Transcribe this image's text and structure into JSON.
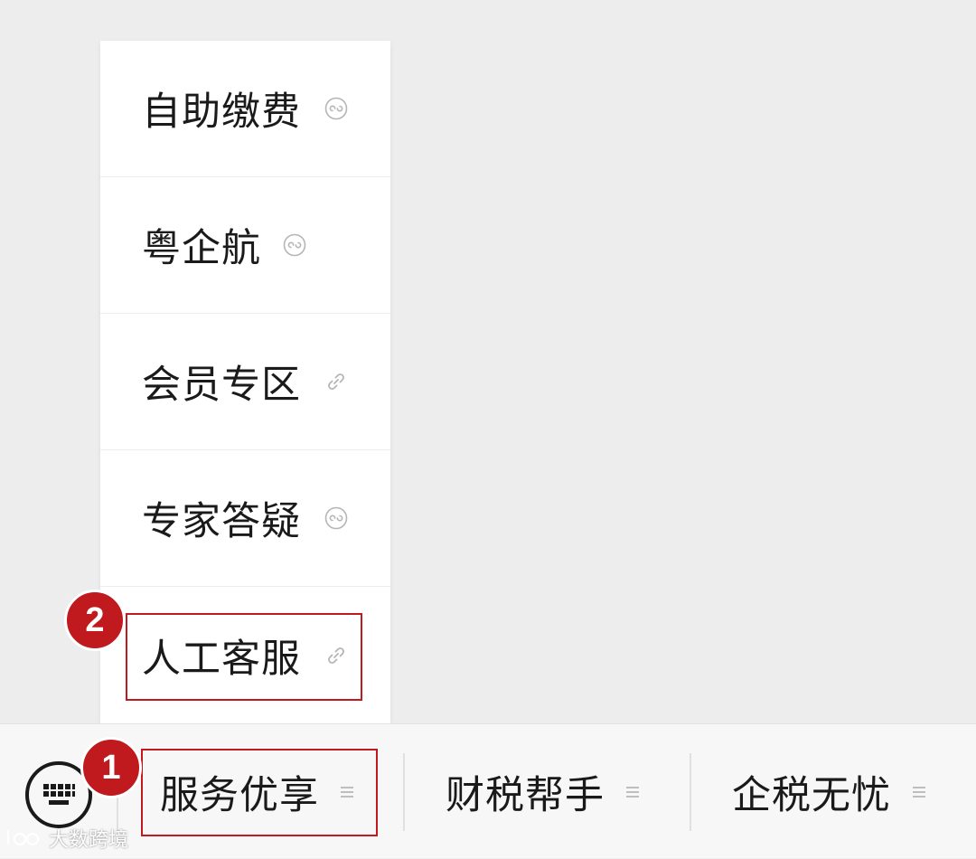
{
  "popup_menu": {
    "items": [
      {
        "label": "自助缴费",
        "icon": "mini-program-icon"
      },
      {
        "label": "粤企航",
        "icon": "mini-program-icon"
      },
      {
        "label": "会员专区",
        "icon": "link-icon"
      },
      {
        "label": "专家答疑",
        "icon": "mini-program-icon"
      },
      {
        "label": "人工客服",
        "icon": "link-icon"
      }
    ]
  },
  "bottom_bar": {
    "keyboard_icon": "keyboard-icon",
    "tabs": [
      {
        "label": "服务优享",
        "icon": "menu-lines-icon"
      },
      {
        "label": "财税帮手",
        "icon": "menu-lines-icon"
      },
      {
        "label": "企税无忧",
        "icon": "menu-lines-icon"
      }
    ]
  },
  "annotations": {
    "step1": "1",
    "step2": "2",
    "highlight_color": "#c0191e"
  },
  "watermark": {
    "text": "大数跨境"
  }
}
